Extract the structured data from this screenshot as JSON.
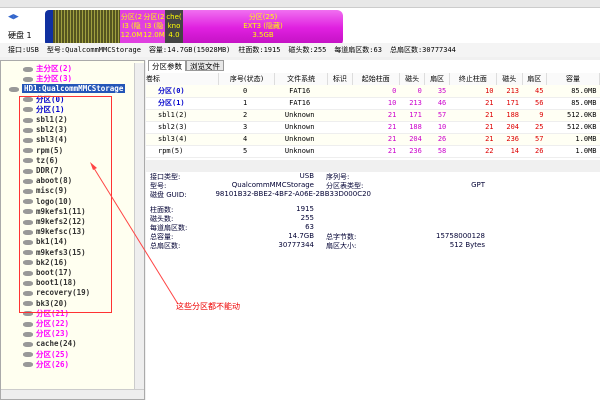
{
  "disk_label": "硬盘 1",
  "disk_bar": [
    {
      "lines": [
        "分区(2",
        "I3 (隐",
        "12.0M"
      ]
    },
    {
      "lines": [
        "分区(2",
        "I3 (隐",
        "12.0M"
      ]
    },
    {
      "lines": [
        "che(",
        "kno",
        "4.0"
      ]
    },
    {
      "lines": [
        "分区(25)",
        "EXT3 (隐藏)",
        "3.5GB"
      ]
    }
  ],
  "info": [
    "接口:USB",
    "型号:QualcommMMCStorage",
    "容量:14.7GB(15028MB)",
    "柱面数:1915",
    "磁头数:255",
    "每道扇区数:63",
    "总扇区数:30777344"
  ],
  "tree": [
    {
      "label": "主分区(2)",
      "color": "#f0f"
    },
    {
      "label": "主分区(3)",
      "color": "#f0f"
    },
    {
      "label": "HD1:QualcommMMCStorage",
      "color": "#fff",
      "sel": true
    },
    {
      "label": "分区(0)",
      "color": "#00c"
    },
    {
      "label": "分区(1)",
      "color": "#00c"
    },
    {
      "label": "sbl1(2)",
      "color": "#333"
    },
    {
      "label": "sbl2(3)",
      "color": "#333"
    },
    {
      "label": "sbl3(4)",
      "color": "#333"
    },
    {
      "label": "rpm(5)",
      "color": "#333"
    },
    {
      "label": "tz(6)",
      "color": "#333"
    },
    {
      "label": "DDR(7)",
      "color": "#333"
    },
    {
      "label": "aboot(8)",
      "color": "#333"
    },
    {
      "label": "misc(9)",
      "color": "#333"
    },
    {
      "label": "logo(10)",
      "color": "#333"
    },
    {
      "label": "m9kefs1(11)",
      "color": "#333"
    },
    {
      "label": "m9kefs2(12)",
      "color": "#333"
    },
    {
      "label": "m9kefsc(13)",
      "color": "#333"
    },
    {
      "label": "bk1(14)",
      "color": "#333"
    },
    {
      "label": "m9kefs3(15)",
      "color": "#333"
    },
    {
      "label": "bk2(16)",
      "color": "#333"
    },
    {
      "label": "boot(17)",
      "color": "#333"
    },
    {
      "label": "boot1(18)",
      "color": "#333"
    },
    {
      "label": "recovery(19)",
      "color": "#333"
    },
    {
      "label": "bk3(20)",
      "color": "#333"
    },
    {
      "label": "分区(21)",
      "color": "#f0f"
    },
    {
      "label": "分区(22)",
      "color": "#f0f"
    },
    {
      "label": "分区(23)",
      "color": "#f0f"
    },
    {
      "label": "cache(24)",
      "color": "#333"
    },
    {
      "label": "分区(25)",
      "color": "#f0f"
    },
    {
      "label": "分区(26)",
      "color": "#f0f"
    }
  ],
  "tabs": [
    "分区参数",
    "浏览文件"
  ],
  "columns": [
    "卷标",
    "序号(状态)",
    "文件系统",
    "标识",
    "起始柱面",
    "磁头",
    "扇区",
    "终止柱面",
    "磁头",
    "扇区",
    "容量"
  ],
  "rows": [
    [
      "分区(0)",
      "0",
      "FAT16",
      "",
      "0",
      "0",
      "35",
      "10",
      "213",
      "45",
      "85.0MB"
    ],
    [
      "分区(1)",
      "1",
      "FAT16",
      "",
      "10",
      "213",
      "46",
      "21",
      "171",
      "56",
      "85.0MB"
    ],
    [
      "sbl1(2)",
      "2",
      "Unknown",
      "",
      "21",
      "171",
      "57",
      "21",
      "188",
      "9",
      "512.0KB"
    ],
    [
      "sbl2(3)",
      "3",
      "Unknown",
      "",
      "21",
      "188",
      "10",
      "21",
      "204",
      "25",
      "512.0KB"
    ],
    [
      "sbl3(4)",
      "4",
      "Unknown",
      "",
      "21",
      "204",
      "26",
      "21",
      "236",
      "57",
      "1.0MB"
    ],
    [
      "rpm(5)",
      "5",
      "Unknown",
      "",
      "21",
      "236",
      "58",
      "22",
      "14",
      "26",
      "1.0MB"
    ]
  ],
  "details": {
    "l1": [
      "接口类型:",
      "USB"
    ],
    "l2": [
      "型号:",
      "QualcommMMCStorage"
    ],
    "l3": [
      "磁盘 GUID:",
      "98101B32-BBE2-4BF2-A06E-2BB33D000C20"
    ],
    "r1": [
      "序列号:",
      ""
    ],
    "r2": [
      "分区表类型:",
      "GPT"
    ],
    "l4": [
      "柱面数:",
      "1915"
    ],
    "l5": [
      "磁头数:",
      "255"
    ],
    "l6": [
      "每道扇区数:",
      "63"
    ],
    "l7": [
      "总容量:",
      "14.7GB"
    ],
    "l8": [
      "总扇区数:",
      "30777344"
    ],
    "r7": [
      "总字节数:",
      "15758000128"
    ],
    "r8": [
      "扇区大小:",
      "512 Bytes"
    ]
  },
  "annotation": "这些分区都不能动"
}
